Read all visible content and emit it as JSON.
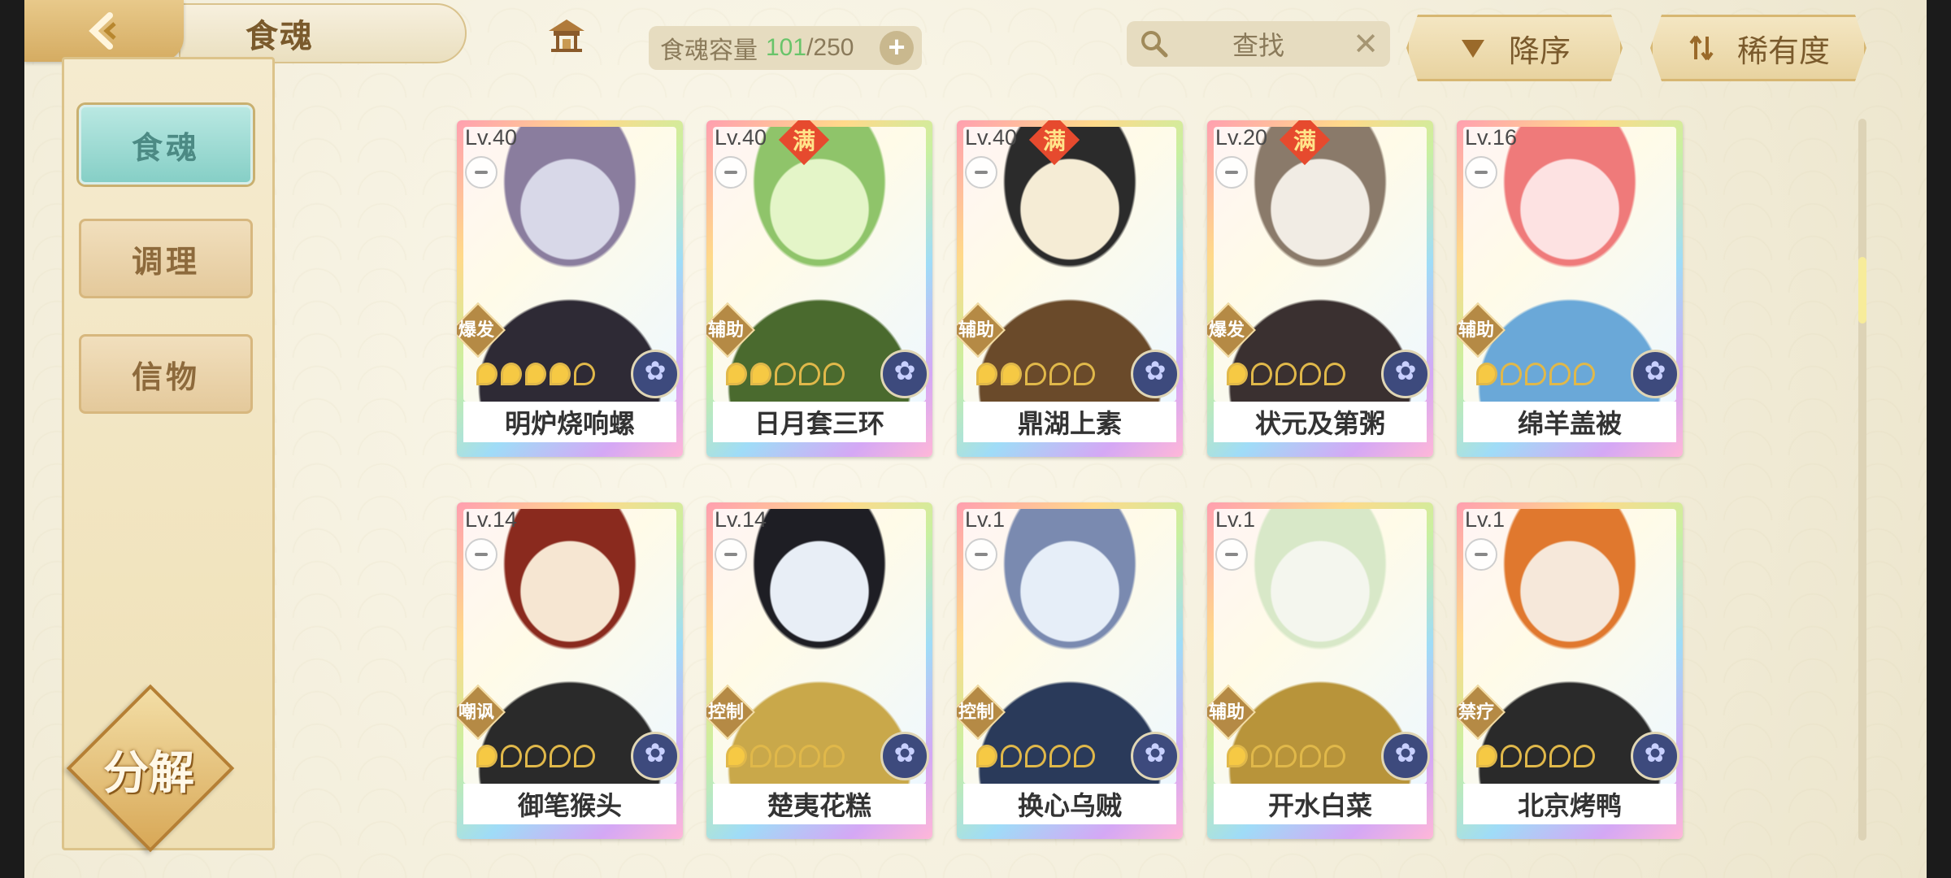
{
  "header": {
    "title": "食魂",
    "capacity_label": "食魂容量",
    "capacity_current": "101",
    "capacity_total": "/250",
    "search_placeholder": "查找",
    "sort_order_label": "降序",
    "sort_key_label": "稀有度"
  },
  "sidebar": {
    "tabs": [
      {
        "label": "食魂"
      },
      {
        "label": "调理"
      },
      {
        "label": "信物"
      }
    ],
    "decompose_label": "分解"
  },
  "cards": [
    {
      "level": "Lv.40",
      "name": "明炉烧响螺",
      "role": "爆发",
      "stars_filled": 4,
      "maxed": false,
      "palette": [
        "#d8d8e8",
        "#8a7d9e",
        "#2e2a35"
      ]
    },
    {
      "level": "Lv.40",
      "name": "日月套三环",
      "role": "辅助",
      "stars_filled": 2,
      "maxed": true,
      "maxed_label": "满",
      "palette": [
        "#e4f5c8",
        "#8fc46a",
        "#4a6a2e"
      ]
    },
    {
      "level": "Lv.40",
      "name": "鼎湖上素",
      "role": "辅助",
      "stars_filled": 2,
      "maxed": true,
      "maxed_label": "满",
      "palette": [
        "#f5ecd5",
        "#2b2b2b",
        "#6a4a2a"
      ]
    },
    {
      "level": "Lv.20",
      "name": "状元及第粥",
      "role": "爆发",
      "stars_filled": 1,
      "maxed": true,
      "maxed_label": "满",
      "palette": [
        "#f1ece4",
        "#8a7a6a",
        "#3a3030"
      ]
    },
    {
      "level": "Lv.16",
      "name": "绵羊盖被",
      "role": "辅助",
      "stars_filled": 1,
      "maxed": false,
      "palette": [
        "#fde2e2",
        "#ef7a7a",
        "#6aa8d8"
      ]
    },
    {
      "level": "Lv.14",
      "name": "御笔猴头",
      "role": "嘲讽",
      "stars_filled": 1,
      "maxed": false,
      "palette": [
        "#f6e6d2",
        "#8a2a1e",
        "#2a2a2a"
      ]
    },
    {
      "level": "Lv.14",
      "name": "楚夷花糕",
      "role": "控制",
      "stars_filled": 1,
      "maxed": false,
      "palette": [
        "#e8eef6",
        "#1e1e24",
        "#c9a84a"
      ]
    },
    {
      "level": "Lv.1",
      "name": "换心乌贼",
      "role": "控制",
      "stars_filled": 1,
      "maxed": false,
      "palette": [
        "#e6eef8",
        "#7a8ab0",
        "#2a3a5a"
      ]
    },
    {
      "level": "Lv.1",
      "name": "开水白菜",
      "role": "辅助",
      "stars_filled": 1,
      "maxed": false,
      "palette": [
        "#f4f6ee",
        "#d8e8c8",
        "#b8943a"
      ]
    },
    {
      "level": "Lv.1",
      "name": "北京烤鸭",
      "role": "禁疗",
      "stars_filled": 1,
      "maxed": false,
      "palette": [
        "#f6e8da",
        "#e0782e",
        "#2a2a2a"
      ]
    }
  ],
  "colors": {
    "accent": "#86cfc6",
    "gold": "#d7b772",
    "capacity_current": "#69c46a"
  }
}
